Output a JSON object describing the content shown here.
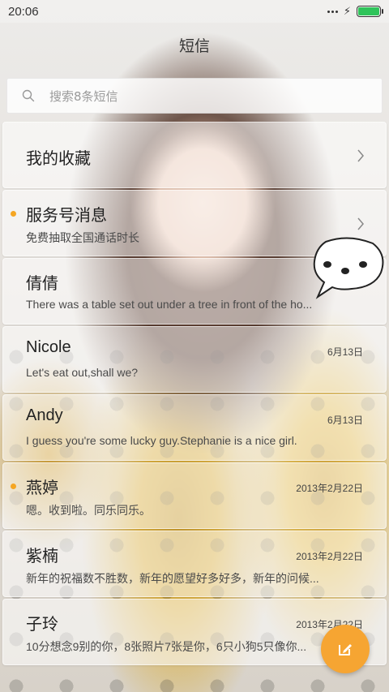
{
  "status_bar": {
    "time": "20:06"
  },
  "header": {
    "title": "短信"
  },
  "search": {
    "placeholder": "搜索8条短信"
  },
  "conversations": [
    {
      "name": "我的收藏",
      "preview": "",
      "date": "",
      "unread": false,
      "chevron": true
    },
    {
      "name": "服务号消息",
      "preview": "免费抽取全国通话时长",
      "date": "",
      "unread": true,
      "chevron": true
    },
    {
      "name": "倩倩",
      "preview": "There was a table set out under a tree in front of the ho...",
      "date": "6月13日",
      "unread": false,
      "chevron": false
    },
    {
      "name": "Nicole",
      "preview": "Let's eat out,shall we?",
      "date": "6月13日",
      "unread": false,
      "chevron": false
    },
    {
      "name": "Andy",
      "preview": "I guess you're some lucky guy.Stephanie is a nice girl.",
      "date": "6月13日",
      "unread": false,
      "chevron": false
    },
    {
      "name": "燕婷",
      "preview": "嗯。收到啦。同乐同乐。",
      "date": "2013年2月22日",
      "unread": true,
      "chevron": false
    },
    {
      "name": "紫楠",
      "preview": "新年的祝福数不胜数，新年的愿望好多好多，新年的问候...",
      "date": "2013年2月22日",
      "unread": false,
      "chevron": false
    },
    {
      "name": "子玲",
      "preview": "10分想念9别的你，8张照片7张是你，6只小狗5只像你...",
      "date": "2013年2月22日",
      "unread": false,
      "chevron": false
    }
  ],
  "colors": {
    "accent": "#f6a532",
    "unread_dot": "#f5a623",
    "battery": "#2fc45a"
  },
  "icons": {
    "search": "search-icon",
    "chevron": "chevron-right-icon",
    "compose": "compose-icon"
  }
}
